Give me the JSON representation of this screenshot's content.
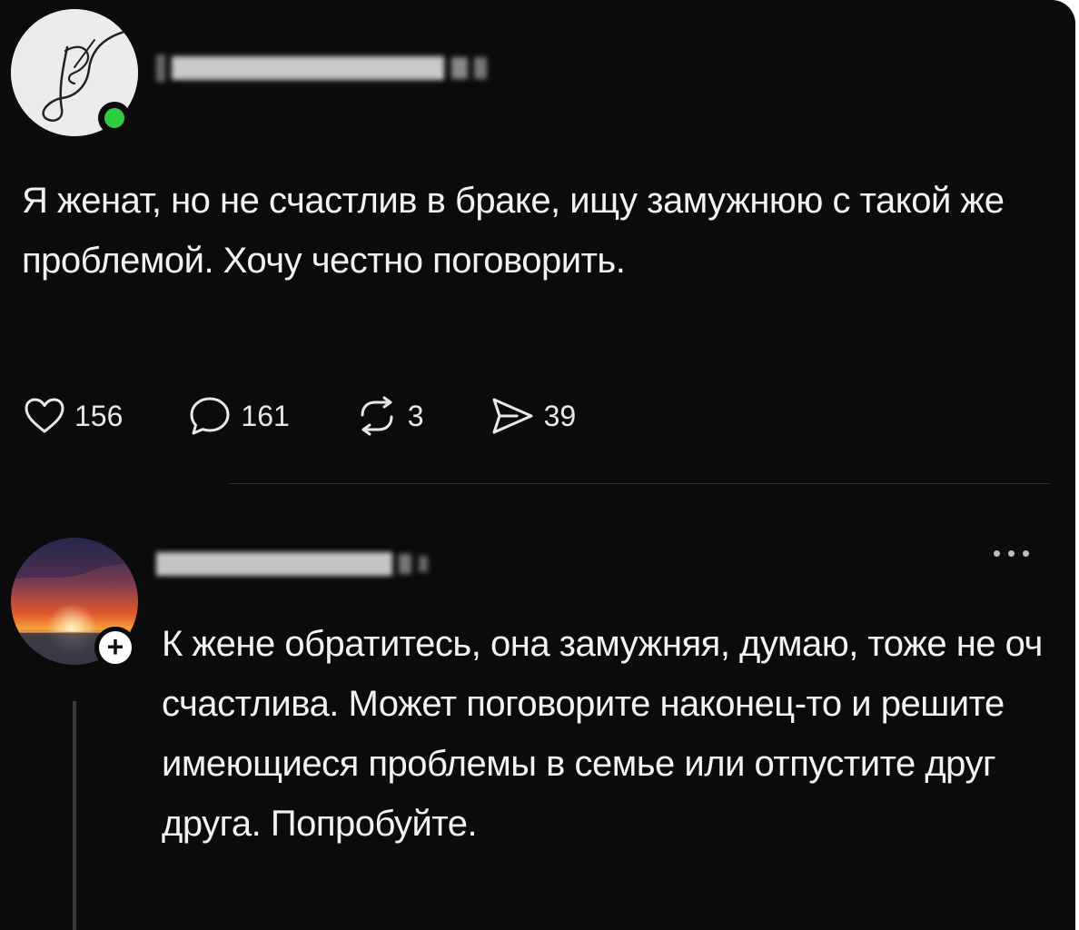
{
  "post": {
    "author_avatar_icon": "signature-avatar-icon",
    "online_status_color": "#2ecc40",
    "text": "Я женат, но не счастлив в браке, ищу замужнюю с такой же проблемой. Хочу честно поговорить.",
    "actions": {
      "likes": "156",
      "comments": "161",
      "reposts": "3",
      "shares": "39"
    }
  },
  "reply": {
    "author_avatar_icon": "sunset-avatar-icon",
    "follow_badge": "+",
    "more_icon": "more-dots-icon",
    "text": "К жене обратитесь, она замужняя, думаю, тоже не оч счастлива. Может поговорите наконец-то и решите имеющиеся проблемы в семье или отпустите друг друга. Попробуйте."
  }
}
